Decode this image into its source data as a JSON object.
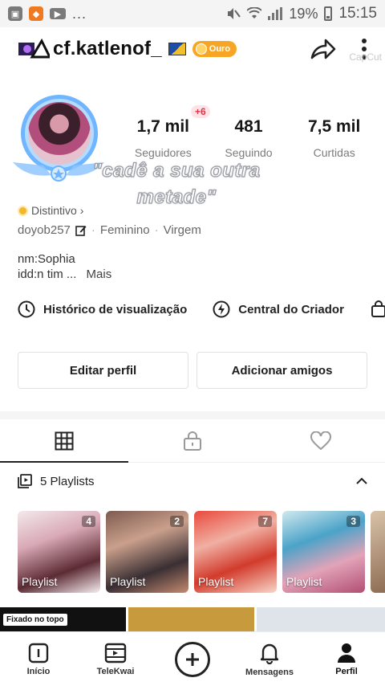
{
  "status_bar": {
    "battery_pct": "19%",
    "time": "15:15",
    "more": "..."
  },
  "header": {
    "username": "cf.katlenof_",
    "badge_label": "Ouro",
    "watermark": "CapCut"
  },
  "profile": {
    "new_followers_badge": "+6",
    "stats": [
      {
        "value": "1,7 mil",
        "label": "Seguidores"
      },
      {
        "value": "481",
        "label": "Seguindo"
      },
      {
        "value": "7,5 mil",
        "label": "Curtidas"
      }
    ],
    "overlay_text_line1": "\"cadê a sua outra",
    "overlay_text_line2": "metade\"",
    "distintivo": "Distintivo",
    "handle": "doyob257",
    "gender": "Feminino",
    "sign": "Virgem",
    "bio_line1": "nm:Sophia",
    "bio_line2": "idd:n tim ...",
    "bio_more": "Mais"
  },
  "tools": {
    "history": "Histórico de visualização",
    "creator_center": "Central do Criador"
  },
  "actions": {
    "edit_profile": "Editar perfil",
    "add_friends": "Adicionar amigos"
  },
  "playlists": {
    "header": "5 Playlists",
    "items": [
      {
        "label": "Playlist",
        "count": "4"
      },
      {
        "label": "Playlist",
        "count": "2"
      },
      {
        "label": "Playlist",
        "count": "7"
      },
      {
        "label": "Playlist",
        "count": "3"
      }
    ]
  },
  "videos": {
    "pinned_label": "Fixado no topo"
  },
  "nav": {
    "home": "Início",
    "telekwai": "TeleKwai",
    "messages": "Mensagens",
    "profile": "Perfil"
  },
  "colors": {
    "ouro_badge": "#f6a624",
    "plus_badge_text": "#e2334a",
    "distintivo_dot": "#f3b72d"
  }
}
